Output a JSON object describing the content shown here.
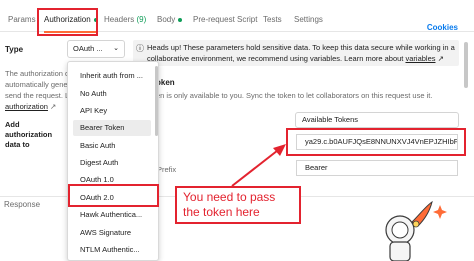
{
  "tabs": [
    {
      "label": "Params"
    },
    {
      "label": "Authorization"
    },
    {
      "label": "Headers",
      "count": "(9)"
    },
    {
      "label": "Body"
    },
    {
      "label": "Pre-request Script"
    },
    {
      "label": "Tests"
    },
    {
      "label": "Settings"
    }
  ],
  "cookies_label": "Cookies",
  "type": {
    "label": "Type",
    "selected": "OAuth ..."
  },
  "left_desc": {
    "lines": [
      "The authorization data",
      "automatically gener",
      "send the request. Le"
    ],
    "link": "authorization"
  },
  "add_auth": {
    "line1": "Add",
    "line2": "authorization",
    "line3": "data to"
  },
  "info_bar": {
    "icon": "info-icon",
    "text": "Heads up! These parameters hold sensitive data. To keep this data secure while working in a collaborative environment, we recommend using variables. Learn more about",
    "link": "variables"
  },
  "token": {
    "heading": "oken",
    "note": "en is only available to you. Sync the token to let collaborators on this request use it.",
    "available": "Available Tokens",
    "value": "ya29.c.b0AUFJQsE8NNUNXVJ4VnEPJZHIbF ...",
    "prefix_label": "Prefix",
    "prefix_value": "Bearer"
  },
  "response_label": "Response",
  "dropdown": [
    "Inherit auth from ...",
    "No Auth",
    "API Key",
    "Bearer Token",
    "Basic Auth",
    "Digest Auth",
    "OAuth 1.0",
    "OAuth 2.0",
    "Hawk Authentica...",
    "AWS Signature",
    "NTLM Authentic..."
  ],
  "callout": {
    "line1": "You need to pass",
    "line2": "the token here"
  },
  "colors": {
    "accent": "#ff6c37",
    "annotation": "#e3232f",
    "link": "#097bed",
    "success": "#0f9d58"
  }
}
